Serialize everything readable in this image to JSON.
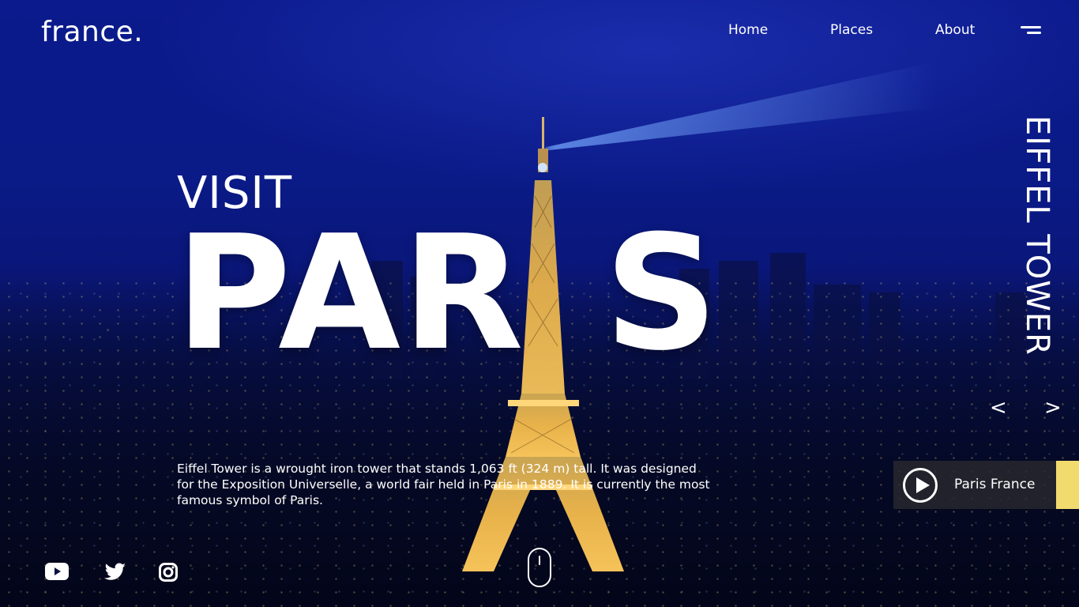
{
  "header": {
    "logo": "france.",
    "nav": [
      "Home",
      "Places",
      "About"
    ]
  },
  "hero": {
    "visit": "VISIT",
    "title_left": "PAR",
    "title_right": "S",
    "description": "Eiffel Tower is a wrought iron tower that stands 1,063 ft (324 m) tall. It was designed for the Exposition Universelle, a world fair held in Paris in 1889. It is currently the most famous symbol of Paris."
  },
  "side": {
    "vertical_label": "EIFFEL TOWER",
    "prev": "<",
    "next": ">"
  },
  "video": {
    "label": "Paris France",
    "icon": "play-icon"
  },
  "social": [
    "youtube-icon",
    "twitter-icon",
    "instagram-icon"
  ],
  "colors": {
    "accent": "#f1db6f",
    "sky": "#0b1a8c",
    "text": "#ffffff",
    "video_box": "#28282d"
  }
}
